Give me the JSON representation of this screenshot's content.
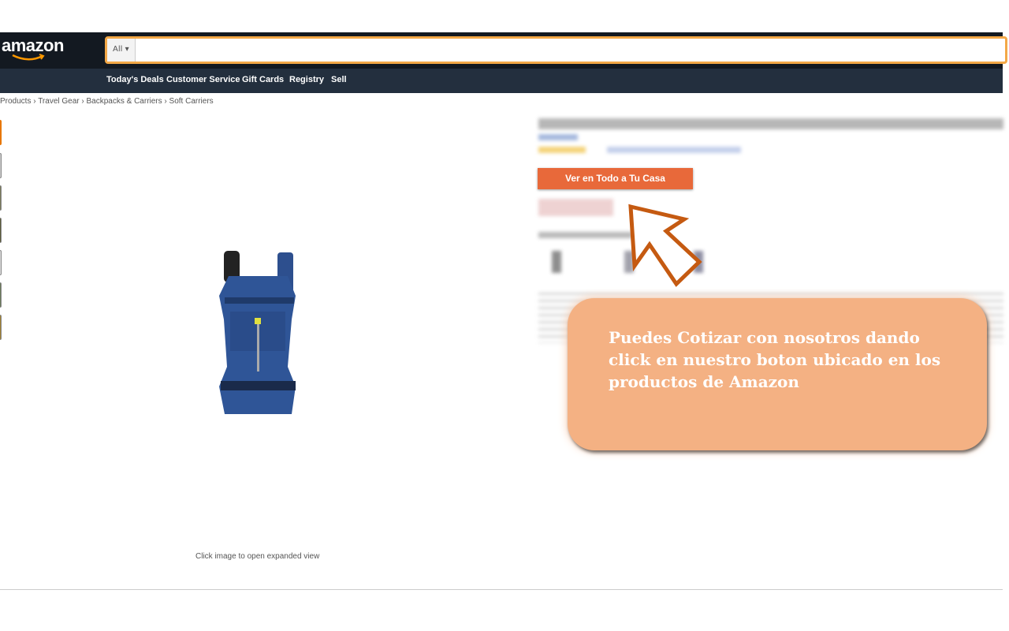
{
  "header": {
    "logo": "amazon",
    "search": {
      "category": "All",
      "value": ""
    }
  },
  "nav": {
    "items": [
      "Today's Deals",
      "Customer Service",
      "Gift Cards",
      "Registry",
      "Sell"
    ]
  },
  "breadcrumb": [
    "Products",
    "Travel Gear",
    "Backpacks & Carriers",
    "Soft Carriers"
  ],
  "product": {
    "image_hint": "Click image to open expanded view"
  },
  "cta": {
    "label": "Ver en Todo a Tu Casa",
    "color": "#e8693a"
  },
  "callout": {
    "text": "Puedes Cotizar con nosotros dando click en nuestro boton ubicado en los productos de Amazon",
    "color": "#f4b183"
  },
  "colors": {
    "header": "#131921",
    "nav": "#232f3e",
    "arrow": "#c55a11"
  }
}
